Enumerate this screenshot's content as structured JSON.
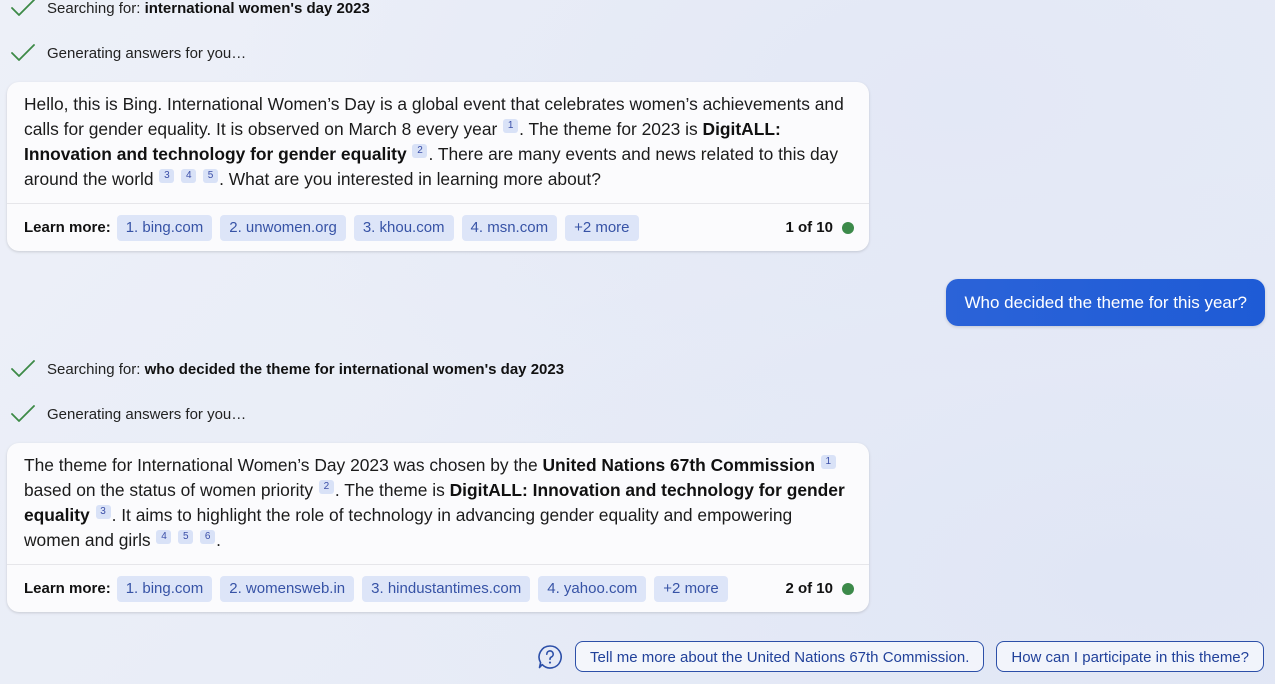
{
  "colors": {
    "accent": "#1e5bd6",
    "check": "#3d8a47",
    "chip_bg": "#dde5f8",
    "chip_text": "#3753a6",
    "status_dot": "#3c8a4a"
  },
  "icons": {
    "check": "check-icon",
    "help": "question-circle-icon",
    "status": "green-dot-icon"
  },
  "turn1": {
    "search_prefix": "Searching for:",
    "search_query": "international women's day 2023",
    "generating": "Generating answers for you…",
    "answer": {
      "t1": "Hello, this is Bing. International Women’s Day is a global event that celebrates women’s achievements and calls for gender equality. It is observed on March 8 every year",
      "c1": "1",
      "t2": ". The theme for 2023 is ",
      "b1": "DigitALL: Innovation and technology for gender equality",
      "c2": "2",
      "t3": ". There are many events and news related to this day around the world",
      "c3": "3",
      "c4": "4",
      "c5": "5",
      "t4": ". What are you interested in learning more about?"
    },
    "learn_more_label": "Learn more:",
    "sources": [
      "1. bing.com",
      "2. unwomen.org",
      "3. khou.com",
      "4. msn.com",
      "+2 more"
    ],
    "page_count": "1 of 10"
  },
  "user_message": "Who decided the theme for this year?",
  "turn2": {
    "search_prefix": "Searching for:",
    "search_query": "who decided the theme for international women's day 2023",
    "generating": "Generating answers for you…",
    "answer": {
      "t1": "The theme for International Women’s Day 2023 was chosen by the ",
      "b1": "United Nations 67th Commission",
      "c1": "1",
      "t2": " based on the status of women priority",
      "c2": "2",
      "t3": ". The theme is ",
      "b2": "DigitALL: Innovation and technology for gender equality",
      "c3": "3",
      "t4": ". It aims to highlight the role of technology in advancing gender equality and empowering women and girls",
      "c4": "4",
      "c5": "5",
      "c6": "6",
      "t5": "."
    },
    "learn_more_label": "Learn more:",
    "sources": [
      "1. bing.com",
      "2. womensweb.in",
      "3. hindustantimes.com",
      "4. yahoo.com",
      "+2 more"
    ],
    "page_count": "2 of 10"
  },
  "suggestions": [
    "Tell me more about the United Nations 67th Commission.",
    "How can I participate in this theme?"
  ]
}
